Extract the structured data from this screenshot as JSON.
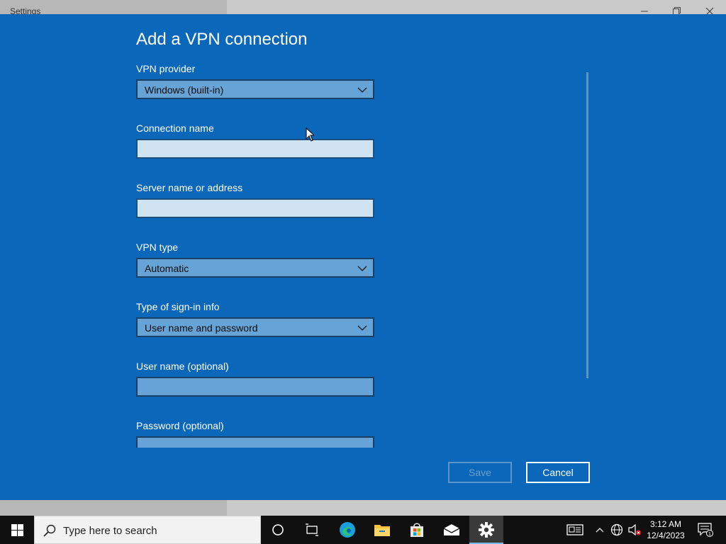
{
  "window": {
    "title": "Settings"
  },
  "dialog": {
    "heading": "Add a VPN connection",
    "fields": {
      "vpn_provider": {
        "label": "VPN provider",
        "value": "Windows (built-in)"
      },
      "connection_name": {
        "label": "Connection name",
        "value": ""
      },
      "server_name": {
        "label": "Server name or address",
        "value": ""
      },
      "vpn_type": {
        "label": "VPN type",
        "value": "Automatic"
      },
      "sign_in_type": {
        "label": "Type of sign-in info",
        "value": "User name and password"
      },
      "user_name": {
        "label": "User name (optional)",
        "value": ""
      },
      "password": {
        "label": "Password (optional)",
        "value": ""
      }
    },
    "buttons": {
      "save": "Save",
      "cancel": "Cancel"
    }
  },
  "taskbar": {
    "search_placeholder": "Type here to search",
    "apps": [
      "cortana-icon",
      "task-view-icon",
      "edge-icon",
      "file-explorer-icon",
      "store-icon",
      "mail-icon",
      "settings-icon"
    ],
    "clock": {
      "time": "3:12 AM",
      "date": "12/4/2023"
    },
    "notification_count": "1"
  },
  "colors": {
    "dialog_bg": "#0b67b9",
    "accent": "#76b9ed",
    "taskbar": "#101010"
  }
}
